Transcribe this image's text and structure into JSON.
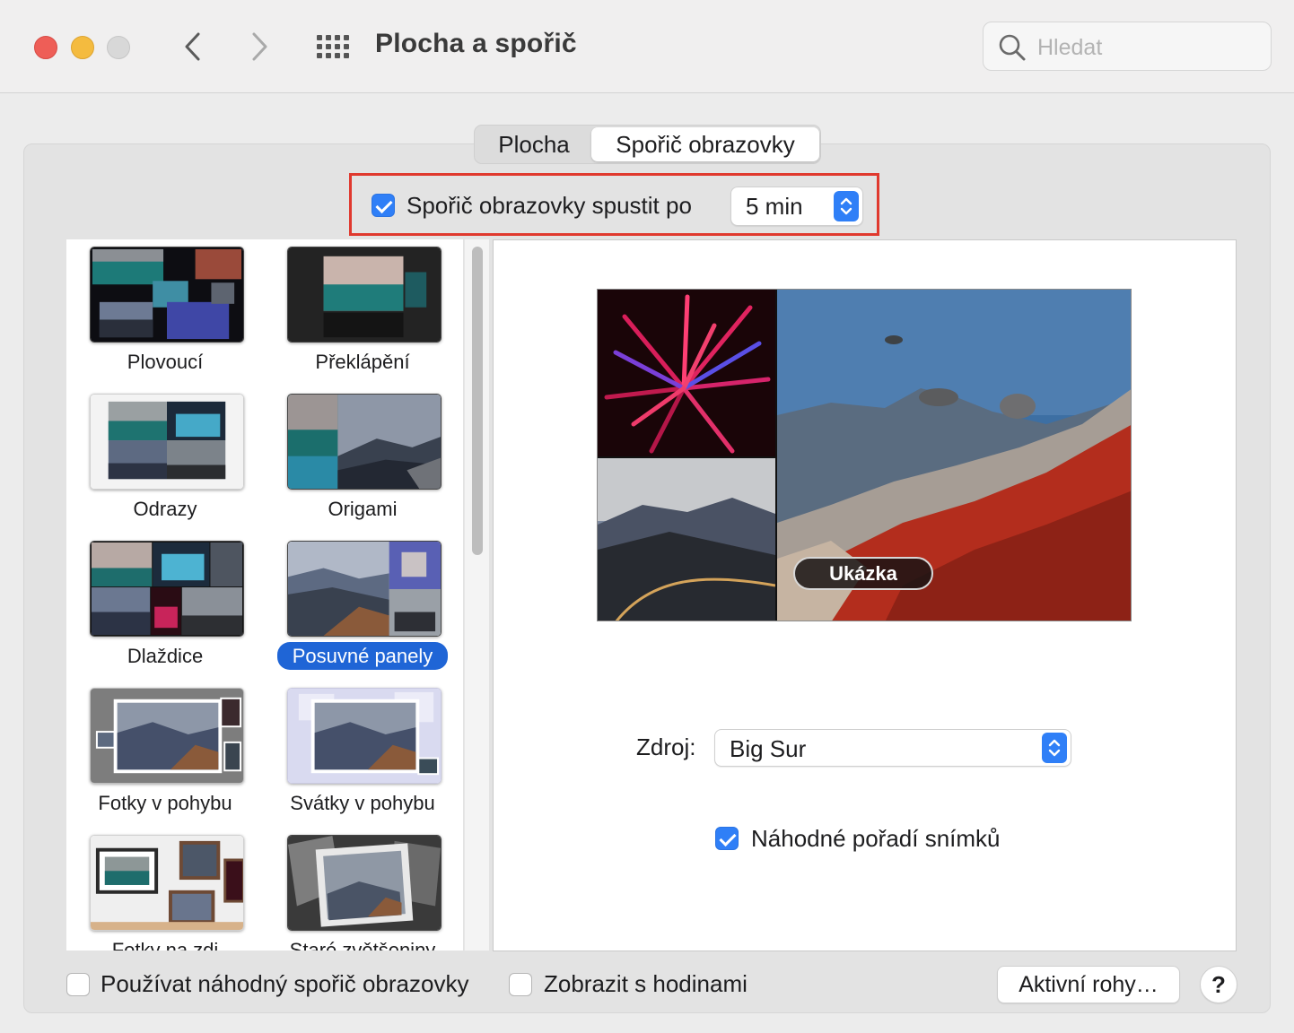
{
  "window": {
    "title": "Plocha a spořič",
    "search_placeholder": "Hledat"
  },
  "tabs": [
    {
      "label": "Plocha",
      "selected": false
    },
    {
      "label": "Spořič obrazovky",
      "selected": true
    }
  ],
  "start_after": {
    "checked": true,
    "label": "Spořič obrazovky spustit po",
    "value": "5 min"
  },
  "screensavers": [
    {
      "label": "Plovoucí",
      "selected": false
    },
    {
      "label": "Překlápění",
      "selected": false
    },
    {
      "label": "Odrazy",
      "selected": false
    },
    {
      "label": "Origami",
      "selected": false
    },
    {
      "label": "Dlaždice",
      "selected": false
    },
    {
      "label": "Posuvné panely",
      "selected": true
    },
    {
      "label": "Fotky v pohybu",
      "selected": false
    },
    {
      "label": "Svátky v pohybu",
      "selected": false
    },
    {
      "label": "Fotky na zdi",
      "selected": false
    },
    {
      "label": "Staré zvětšeniny",
      "selected": false
    }
  ],
  "preview": {
    "button_label": "Ukázka"
  },
  "source": {
    "label": "Zdroj:",
    "value": "Big Sur"
  },
  "shuffle": {
    "checked": true,
    "label": "Náhodné pořadí snímků"
  },
  "bottom": {
    "use_random_checked": false,
    "use_random_label": "Používat náhodný spořič obrazovky",
    "show_clock_checked": false,
    "show_clock_label": "Zobrazit s hodinami",
    "hot_corners_label": "Aktivní rohy…",
    "help_label": "?"
  },
  "colors": {
    "accent": "#2f7ff7",
    "selection": "#1f65d6",
    "highlight_border": "#e0392e"
  }
}
